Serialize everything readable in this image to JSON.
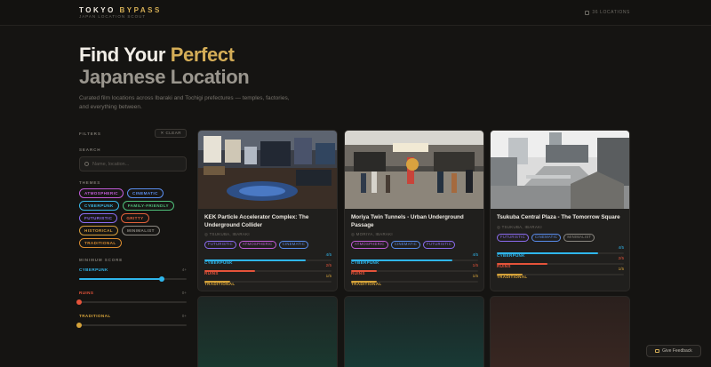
{
  "header": {
    "logo_main": "TOKYO ",
    "logo_accent": "BYPASS",
    "tagline": "JAPAN LOCATION SCOUT",
    "location_count": "36 LOCATIONS"
  },
  "hero": {
    "title_lead": "Find Your ",
    "title_accent": "Perfect",
    "title_line2": "Japanese Location",
    "description": "Curated film locations across Ibaraki and Tochigi prefectures — temples, factories, and everything between."
  },
  "filters": {
    "label": "FILTERS",
    "clear_label": "✕ CLEAR",
    "search_label": "SEARCH",
    "search_placeholder": "Name, location...",
    "themes_label": "THEMES",
    "themes": [
      {
        "label": "ATMOSPHERIC",
        "color": "#c15cd8"
      },
      {
        "label": "CINEMATIC",
        "color": "#5a8dee"
      },
      {
        "label": "CYBERPUNK",
        "color": "#39b7e6"
      },
      {
        "label": "FAMILY-FRIENDLY",
        "color": "#4fbf7a"
      },
      {
        "label": "FUTURISTIC",
        "color": "#8b6cf0"
      },
      {
        "label": "GRITTY",
        "color": "#e0603a"
      },
      {
        "label": "HISTORICAL",
        "color": "#d29b3c"
      },
      {
        "label": "MINIMALIST",
        "color": "#8a8780"
      },
      {
        "label": "TRADITIONAL",
        "color": "#d88a2f"
      }
    ],
    "min_score_label": "MINIMUM SCORE",
    "scores": [
      {
        "label": "CYBERPUNK",
        "value": "4+",
        "level": 0.77,
        "color": "#2fb6ec"
      },
      {
        "label": "RUINS",
        "value": "0+",
        "level": 0,
        "color": "#e5533a"
      },
      {
        "label": "TRADITIONAL",
        "value": "0+",
        "level": 0,
        "color": "#d4a23a"
      }
    ]
  },
  "cards": [
    {
      "title": "KEK Particle Accelerator Complex: The Underground Collider",
      "location": "TSUKUBA, IBARAKI",
      "tags": [
        {
          "label": "FUTURISTIC",
          "color": "#8b6cf0"
        },
        {
          "label": "ATMOSPHERIC",
          "color": "#c15cd8"
        },
        {
          "label": "CINEMATIC",
          "color": "#5a8dee"
        }
      ],
      "scores": [
        {
          "label": "CYBERPUNK",
          "value": "4/5",
          "level": 0.8,
          "color": "#2fb6ec"
        },
        {
          "label": "RUINS",
          "value": "2/5",
          "level": 0.4,
          "color": "#e5533a"
        },
        {
          "label": "TRADITIONAL",
          "value": "1/5",
          "level": 0.2,
          "color": "#d4a23a"
        }
      ]
    },
    {
      "title": "Moriya Twin Tunnels - Urban Underground Passage",
      "location": "MORIYA, IBARAKI",
      "tags": [
        {
          "label": "ATMOSPHERIC",
          "color": "#c15cd8"
        },
        {
          "label": "CINEMATIC",
          "color": "#5a8dee"
        },
        {
          "label": "FUTURISTIC",
          "color": "#8b6cf0"
        }
      ],
      "scores": [
        {
          "label": "CYBERPUNK",
          "value": "4/5",
          "level": 0.8,
          "color": "#2fb6ec"
        },
        {
          "label": "RUINS",
          "value": "1/5",
          "level": 0.2,
          "color": "#e5533a"
        },
        {
          "label": "TRADITIONAL",
          "value": "1/5",
          "level": 0.2,
          "color": "#d4a23a"
        }
      ]
    },
    {
      "title": "Tsukuba Central Plaza - The Tomorrow Square",
      "location": "TSUKUBA, IBARAKI",
      "tags": [
        {
          "label": "FUTURISTIC",
          "color": "#8b6cf0"
        },
        {
          "label": "CINEMATIC",
          "color": "#5a8dee"
        },
        {
          "label": "MINIMALIST",
          "color": "#8a8780"
        }
      ],
      "scores": [
        {
          "label": "CYBERPUNK",
          "value": "4/5",
          "level": 0.8,
          "color": "#2fb6ec"
        },
        {
          "label": "RUINS",
          "value": "2/5",
          "level": 0.4,
          "color": "#e5533a"
        },
        {
          "label": "TRADITIONAL",
          "value": "1/5",
          "level": 0.2,
          "color": "#d4a23a"
        }
      ]
    }
  ],
  "feedback_label": "Give Feedback"
}
